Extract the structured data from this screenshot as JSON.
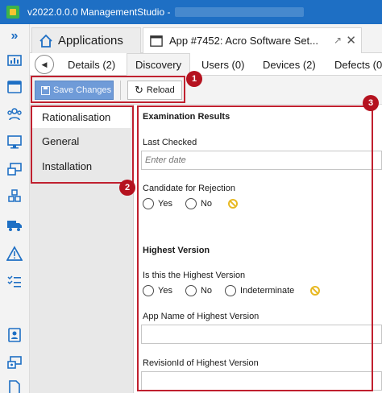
{
  "window": {
    "title": "v2022.0.0.0 ManagementStudio -"
  },
  "rail": {
    "icons": [
      "dashboard-icon",
      "window-icon",
      "users-icon",
      "computer-icon",
      "devices-icon",
      "cubes-icon",
      "truck-icon",
      "warning-icon",
      "checklist-icon",
      "contact-icon",
      "devices-alt-icon",
      "document-icon"
    ]
  },
  "doc_tabs": {
    "applications_label": "Applications",
    "app_label": "App #7452: Acro Software Set...",
    "pin_glyph": "↗",
    "close_glyph": "✕"
  },
  "sub_tabs": {
    "back_glyph": "◀",
    "items": [
      "Details (2)",
      "Discovery",
      "Users (0)",
      "Devices (2)",
      "Defects (0"
    ]
  },
  "toolbar": {
    "save_label": "Save Changes",
    "reload_label": "Reload",
    "reload_glyph": "↻"
  },
  "callouts": [
    "1",
    "2",
    "3"
  ],
  "subnav": {
    "items": [
      "Rationalisation",
      "General",
      "Installation"
    ]
  },
  "content": {
    "section1_title": "Examination Results",
    "last_checked_label": "Last Checked",
    "last_checked_placeholder": "Enter date",
    "candidate_label": "Candidate for Rejection",
    "yes_label": "Yes",
    "no_label": "No",
    "section2_title": "Highest Version",
    "is_highest_label": "Is this the Highest Version",
    "indeterminate_label": "Indeterminate",
    "app_name_label": "App Name of Highest Version",
    "revision_label": "RevisionId of Highest Version"
  },
  "colors": {
    "accent": "#1e6fc4",
    "save_button": "#6f9bd8",
    "callout": "#c0202f",
    "clear_icon": "#e8b923"
  }
}
